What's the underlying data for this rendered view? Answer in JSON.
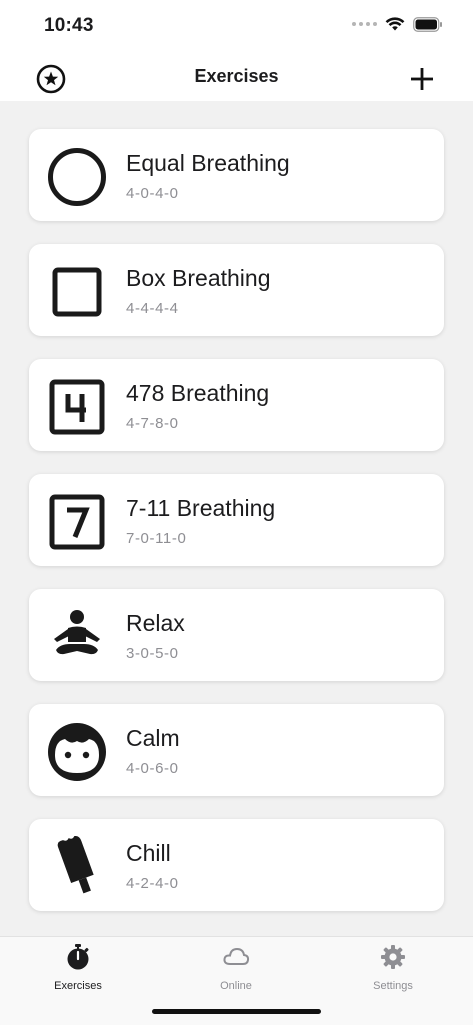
{
  "status_bar": {
    "time": "10:43"
  },
  "nav": {
    "title": "Exercises",
    "left_icon": "star-circle-icon",
    "right_icon": "plus-icon"
  },
  "exercises": [
    {
      "title": "Equal Breathing",
      "pattern": "4-0-4-0",
      "icon": "circle-outline-icon"
    },
    {
      "title": "Box Breathing",
      "pattern": "4-4-4-4",
      "icon": "square-outline-icon"
    },
    {
      "title": "478 Breathing",
      "pattern": "4-7-8-0",
      "icon": "number-four-box-icon"
    },
    {
      "title": "7-11 Breathing",
      "pattern": "7-0-11-0",
      "icon": "number-seven-box-icon"
    },
    {
      "title": "Relax",
      "pattern": "3-0-5-0",
      "icon": "meditation-icon"
    },
    {
      "title": "Calm",
      "pattern": "4-0-6-0",
      "icon": "face-icon"
    },
    {
      "title": "Chill",
      "pattern": "4-2-4-0",
      "icon": "ice-pop-icon"
    }
  ],
  "tabs": [
    {
      "label": "Exercises",
      "icon": "stopwatch-icon",
      "active": true
    },
    {
      "label": "Online",
      "icon": "cloud-icon",
      "active": false
    },
    {
      "label": "Settings",
      "icon": "gear-icon",
      "active": false
    }
  ],
  "colors": {
    "background": "#f1f1f1",
    "card": "#ffffff",
    "text": "#1c1c1e",
    "subtext": "#8e8e93",
    "inactive_tab": "#8e8e93"
  }
}
